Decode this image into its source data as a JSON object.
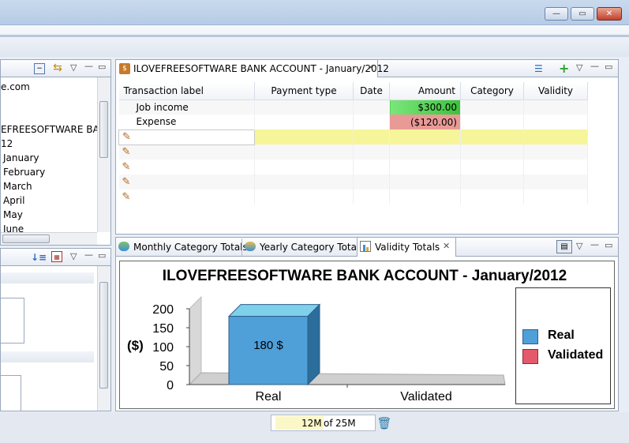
{
  "window": {
    "minimize_glyph": "—",
    "maximize_glyph": "▭",
    "close_glyph": "✕"
  },
  "left_tree": {
    "items": [
      {
        "label": "e.com"
      },
      {
        "label": "EFREESOFTWARE BANK A"
      },
      {
        "label": "12"
      },
      {
        "label": "January"
      },
      {
        "label": "February"
      },
      {
        "label": "March"
      },
      {
        "label": "April"
      },
      {
        "label": "May"
      },
      {
        "label": "June"
      }
    ]
  },
  "account_view": {
    "title": "ILOVEFREESOFTWARE BANK ACCOUNT - January/2012",
    "columns": [
      "Transaction label",
      "Payment type",
      "Date",
      "Amount",
      "Category",
      "Validity"
    ],
    "rows": [
      {
        "label": "Job income",
        "payment_type": "",
        "date": "",
        "amount": "$300.00",
        "category": "",
        "validity": ""
      },
      {
        "label": "Expense",
        "payment_type": "",
        "date": "",
        "amount": "($120.00)",
        "category": "",
        "validity": ""
      }
    ],
    "colors": {
      "income": "#4ed44e",
      "expense": "#e88a8a",
      "edit_row": "#f6f59a"
    }
  },
  "bottom_tabs": [
    {
      "label": "Monthly Category Totals"
    },
    {
      "label": "Yearly Category Totals"
    },
    {
      "label": "Validity Totals"
    }
  ],
  "chart_data": {
    "type": "bar",
    "title": "ILOVEFREESOFTWARE BANK ACCOUNT - January/2012",
    "ylabel": "($)",
    "categories": [
      "Real",
      "Validated"
    ],
    "series": [
      {
        "name": "Real",
        "values": [
          180,
          0
        ]
      },
      {
        "name": "Validated",
        "values": [
          0,
          0
        ]
      }
    ],
    "ylim": [
      0,
      200
    ],
    "yticks": [
      "200",
      "150",
      "100",
      "50",
      "0"
    ],
    "data_label": "180 $",
    "colors": {
      "Real": "#4f9fd8",
      "Validated": "#e55a6a"
    },
    "legend": "right"
  },
  "status": {
    "heap_used": "12M",
    "of": "of",
    "heap_total": "25M"
  }
}
